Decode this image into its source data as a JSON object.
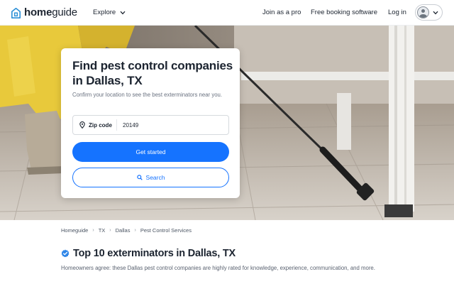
{
  "header": {
    "logo_bold": "home",
    "logo_light": "guide",
    "explore_label": "Explore",
    "nav": {
      "join_pro": "Join as a pro",
      "booking": "Free booking software",
      "login": "Log in"
    }
  },
  "hero_card": {
    "title": "Find pest control companies in Dallas, TX",
    "subtitle": "Confirm your location to see the best exterminators near you.",
    "zip_label": "Zip code",
    "zip_value": "20149",
    "primary_button": "Get started",
    "secondary_button": "Search"
  },
  "breadcrumb": [
    "Homeguide",
    "TX",
    "Dallas",
    "Pest Control Services"
  ],
  "section": {
    "title": "Top 10 exterminators in Dallas, TX",
    "description": "Homeowners agree: these Dallas pest control companies are highly rated for knowledge, experience, communication, and more."
  },
  "colors": {
    "brand_blue": "#1573ff",
    "logo_blue": "#2a8fd6",
    "text_dark": "#1c2430",
    "verified_badge": "#2f86e8"
  },
  "icons": [
    "home-logo-icon",
    "chevron-down-icon",
    "avatar-icon",
    "location-pin-icon",
    "search-icon",
    "verified-badge-icon"
  ]
}
